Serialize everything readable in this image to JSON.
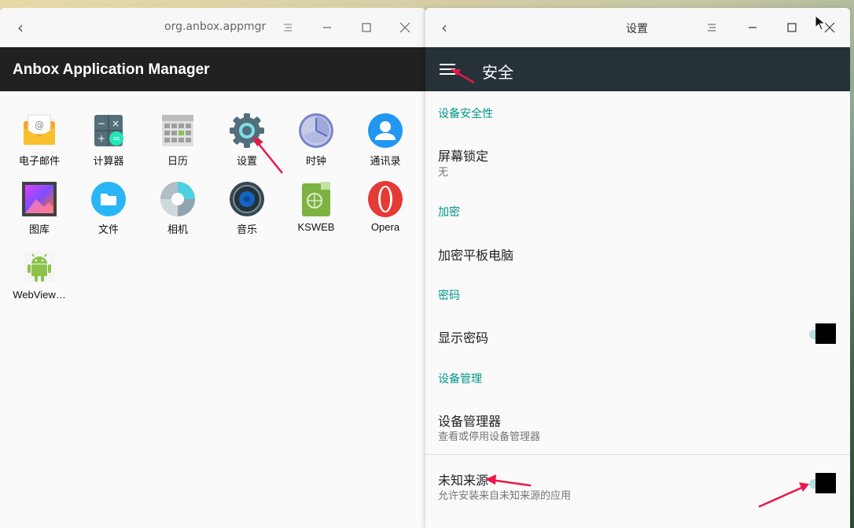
{
  "left_window": {
    "title": "org.anbox.appmgr",
    "app_title": "Anbox Application Manager",
    "apps": [
      {
        "label": "电子邮件",
        "icon": "email-icon"
      },
      {
        "label": "计算器",
        "icon": "calculator-icon"
      },
      {
        "label": "日历",
        "icon": "calendar-icon"
      },
      {
        "label": "设置",
        "icon": "settings-icon"
      },
      {
        "label": "时钟",
        "icon": "clock-icon"
      },
      {
        "label": "通讯录",
        "icon": "contacts-icon"
      },
      {
        "label": "图库",
        "icon": "gallery-icon"
      },
      {
        "label": "文件",
        "icon": "files-icon"
      },
      {
        "label": "相机",
        "icon": "camera-icon"
      },
      {
        "label": "音乐",
        "icon": "music-icon"
      },
      {
        "label": "KSWEB",
        "icon": "ksweb-icon"
      },
      {
        "label": "Opera",
        "icon": "opera-icon"
      },
      {
        "label": "WebView…",
        "icon": "android-icon"
      }
    ]
  },
  "right_window": {
    "title": "设置",
    "app_title": "安全",
    "sections": {
      "device_security": "设备安全性",
      "encryption": "加密",
      "password": "密码",
      "device_admin": "设备管理"
    },
    "items": {
      "screen_lock": {
        "title": "屏幕锁定",
        "sub": "无"
      },
      "encrypt_tablet": {
        "title": "加密平板电脑"
      },
      "show_password": {
        "title": "显示密码"
      },
      "device_admins": {
        "title": "设备管理器",
        "sub": "查看或停用设备管理器"
      },
      "unknown_sources": {
        "title": "未知来源",
        "sub": "允许安装来自未知来源的应用"
      }
    }
  },
  "colors": {
    "left_appbar": "#212121",
    "right_appbar": "#263238",
    "section_accent": "#009688",
    "annotation_arrow": "#e8174a"
  }
}
